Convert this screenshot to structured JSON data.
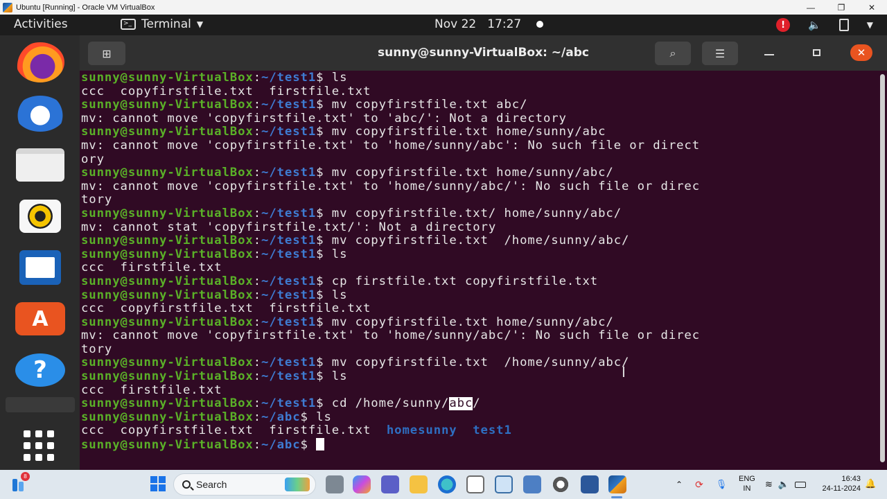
{
  "vbox": {
    "title": "Ubuntu [Running] - Oracle VM VirtualBox",
    "min": "—",
    "max": "❐",
    "close": "✕"
  },
  "topbar": {
    "activities": "Activities",
    "app_menu": "Terminal",
    "date": "Nov 22",
    "time": "17:27",
    "alert": "!"
  },
  "dock": {
    "items": [
      "firefox-icon",
      "thunderbird-icon",
      "files-icon",
      "rhythmbox-icon",
      "writer-icon",
      "app-center-icon",
      "help-icon"
    ],
    "help_label": "?",
    "appcenter_label": "A"
  },
  "terminal": {
    "title": "sunny@sunny-VirtualBox: ~/abc",
    "close_label": "✕",
    "user_host": "sunny@sunny-VirtualBox",
    "colon": ":",
    "lines": [
      {
        "kind": "prompt",
        "path": "~/test1",
        "cmd": " ls"
      },
      {
        "kind": "out",
        "text": "ccc  copyfirstfile.txt  firstfile.txt"
      },
      {
        "kind": "prompt",
        "path": "~/test1",
        "cmd": " mv copyfirstfile.txt abc/"
      },
      {
        "kind": "out",
        "text": "mv: cannot move 'copyfirstfile.txt' to 'abc/': Not a directory"
      },
      {
        "kind": "prompt",
        "path": "~/test1",
        "cmd": " mv copyfirstfile.txt home/sunny/abc"
      },
      {
        "kind": "out",
        "text": "mv: cannot move 'copyfirstfile.txt' to 'home/sunny/abc': No such file or direct"
      },
      {
        "kind": "out",
        "text": "ory"
      },
      {
        "kind": "prompt",
        "path": "~/test1",
        "cmd": " mv copyfirstfile.txt home/sunny/abc/"
      },
      {
        "kind": "out",
        "text": "mv: cannot move 'copyfirstfile.txt' to 'home/sunny/abc/': No such file or direc"
      },
      {
        "kind": "out",
        "text": "tory"
      },
      {
        "kind": "prompt",
        "path": "~/test1",
        "cmd": " mv copyfirstfile.txt/ home/sunny/abc/"
      },
      {
        "kind": "out",
        "text": "mv: cannot stat 'copyfirstfile.txt/': Not a directory"
      },
      {
        "kind": "prompt",
        "path": "~/test1",
        "cmd": " mv copyfirstfile.txt  /home/sunny/abc/"
      },
      {
        "kind": "prompt",
        "path": "~/test1",
        "cmd": " ls"
      },
      {
        "kind": "out",
        "text": "ccc  firstfile.txt"
      },
      {
        "kind": "prompt",
        "path": "~/test1",
        "cmd": " cp firstfile.txt copyfirstfile.txt"
      },
      {
        "kind": "prompt",
        "path": "~/test1",
        "cmd": " ls"
      },
      {
        "kind": "out",
        "text": "ccc  copyfirstfile.txt  firstfile.txt"
      },
      {
        "kind": "prompt",
        "path": "~/test1",
        "cmd": " mv copyfirstfile.txt home/sunny/abc/"
      },
      {
        "kind": "out",
        "text": "mv: cannot move 'copyfirstfile.txt' to 'home/sunny/abc/': No such file or direc"
      },
      {
        "kind": "out",
        "text": "tory"
      },
      {
        "kind": "prompt",
        "path": "~/test1",
        "cmd": " mv copyfirstfile.txt  /home/sunny/abc/"
      },
      {
        "kind": "prompt",
        "path": "~/test1",
        "cmd": " ls"
      },
      {
        "kind": "out",
        "text": "ccc  firstfile.txt"
      },
      {
        "kind": "prompt_hl",
        "path": "~/test1",
        "cmd_pre": " cd /home/sunny/",
        "cmd_hl": "abc",
        "cmd_post": "/"
      },
      {
        "kind": "prompt",
        "path": "~/abc",
        "cmd": " ls"
      },
      {
        "kind": "ls_dirs",
        "text": "ccc  copyfirstfile.txt  firstfile.txt  ",
        "dir1": "homesunny",
        "sep": "  ",
        "dir2": "test1"
      },
      {
        "kind": "prompt_cursor",
        "path": "~/abc",
        "cmd": " "
      }
    ]
  },
  "taskbar": {
    "badge": "8",
    "search_placeholder": "Search",
    "lang_line1": "ENG",
    "lang_line2": "IN",
    "time": "16:43",
    "date": "24-11-2024"
  }
}
